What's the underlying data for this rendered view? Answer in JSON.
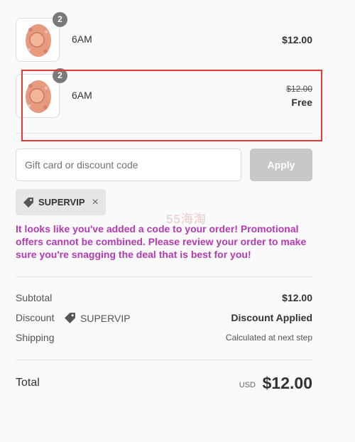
{
  "items": [
    {
      "name": "6AM",
      "qty": "2",
      "price": "$12.00"
    },
    {
      "name": "6AM",
      "qty": "2",
      "original_price": "$12.00",
      "price": "Free"
    }
  ],
  "discount": {
    "placeholder": "Gift card or discount code",
    "apply_label": "Apply",
    "applied_code": "SUPERVIP",
    "remove_symbol": "×"
  },
  "watermark": "55海淘",
  "promo_message": "It looks like you've added a code to your order! Promotional offers cannot be combined. Please review your order to make sure you're snagging the deal that is best for you!",
  "summary": {
    "subtotal_label": "Subtotal",
    "subtotal_value": "$12.00",
    "discount_label": "Discount",
    "discount_code": "SUPERVIP",
    "discount_value": "Discount Applied",
    "shipping_label": "Shipping",
    "shipping_value": "Calculated at next step"
  },
  "total": {
    "label": "Total",
    "currency": "USD",
    "amount": "$12.00"
  },
  "colors": {
    "promo_text": "#b23ab3",
    "highlight_border": "#e53935",
    "apply_button": "#c8c8c8"
  }
}
